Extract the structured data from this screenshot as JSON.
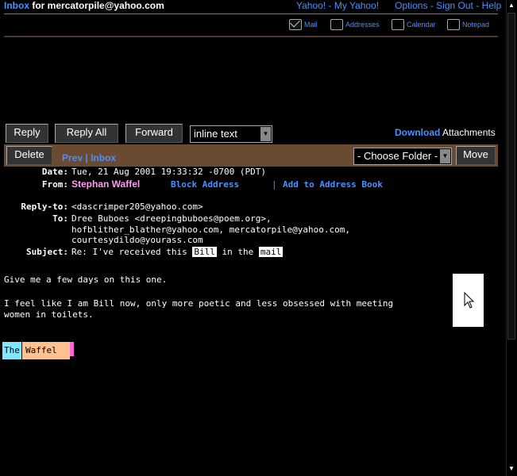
{
  "header": {
    "inbox_label": "Inbox",
    "inbox_for": "for mercatorpile@yahoo.com",
    "links": [
      "Yahoo!",
      "My Yahoo!",
      "Options",
      "Sign Out",
      "Help"
    ]
  },
  "toolbar_icons": [
    {
      "label": "Mail",
      "icon": "mail-icon"
    },
    {
      "label": "Addresses",
      "icon": "addresses-icon"
    },
    {
      "label": "Calendar",
      "icon": "calendar-icon"
    },
    {
      "label": "Notepad",
      "icon": "notepad-icon"
    }
  ],
  "buttons": {
    "reply": "Reply",
    "reply_all": "Reply All",
    "forward": "Forward",
    "forward_mode": "inline text",
    "delete": "Delete",
    "move": "Move",
    "choose_folder": "- Choose Folder -"
  },
  "download": {
    "link": "Download",
    "text": "Attachments"
  },
  "nav": {
    "prev": "Prev",
    "sep": "|",
    "inbox": "Inbox"
  },
  "message": {
    "date_label": "Date:",
    "date": "Tue, 21 Aug 2001 19:33:32 -0700 (PDT)",
    "from_label": "From:",
    "from_name": "Stephan Waffel",
    "block_address": "Block Address",
    "link_sep": "|",
    "add_to_book": "Add to Address Book",
    "replyto_label": "Reply-to:",
    "replyto": "<dascrimper205@yahoo.com>",
    "to_label": "To:",
    "to_lines": [
      "Dree Buboes <dreepingbuboes@poem.org>,",
      "hofblither_blather@yahoo.com, mercatorpile@yahoo.com,",
      "courtesydildo@yourass.com"
    ],
    "subject_label": "Subject:",
    "subject_pre": "Re: I've received this",
    "subject_word1": "Bill",
    "subject_mid": "in the",
    "subject_word2": "mail",
    "body_lines": [
      "Give me a few days on this one.",
      "I feel like I am Bill now, only more poetic and less obsessed with meeting",
      "women in toilets."
    ],
    "signature_the": "The",
    "signature_waffel": "Waffel"
  }
}
